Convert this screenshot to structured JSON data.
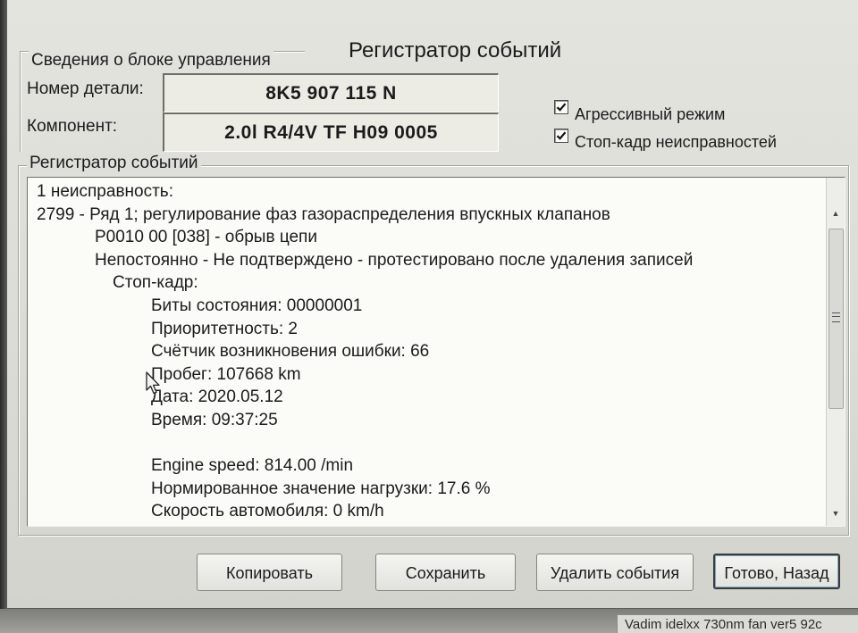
{
  "window": {
    "title": "Регистратор событий"
  },
  "control_unit": {
    "legend": "Сведения о блоке управления",
    "part_number": {
      "label": "Номер детали:",
      "value": "8K5 907 115 N"
    },
    "component": {
      "label": "Компонент:",
      "value": "2.0l R4/4V TF H09 0005"
    }
  },
  "options": [
    {
      "label": "Агрессивный режим",
      "checked": true
    },
    {
      "label": "Стоп-кадр неисправностей",
      "checked": true
    }
  ],
  "event_log": {
    "legend": "Регистратор событий",
    "lines": [
      "1 неисправность:",
      "2799 - Ряд 1; регулирование фаз газораспределения впускных клапанов",
      "P0010 00 [038] - обрыв цепи",
      "Непостоянно - Не подтверждено - протестировано после удаления записей",
      "Стоп-кадр:",
      "Биты состояния: 00000001",
      "Приоритетность: 2",
      "Счётчик возникновения ошибки: 66",
      "Пробег: 107668 km",
      "Дата: 2020.05.12",
      "Время: 09:37:25",
      "Engine speed: 814.00 /min",
      "Нормированное значение нагрузки: 17.6 %",
      "Скорость автомобиля: 0 km/h"
    ]
  },
  "buttons": {
    "copy": "Копировать",
    "save": "Сохранить",
    "delete_events": "Удалить события",
    "done_back": "Готово, Назад"
  },
  "taskbar": {
    "item": "Vadim idelxx 730nm fan ver5 92c"
  },
  "icons": {
    "checkbox_mark": "check-icon",
    "scroll_up": "triangle-up-icon",
    "scroll_down": "triangle-down-icon",
    "scroll_grip": "grip-lines-icon",
    "pointer": "arrow-cursor-icon"
  },
  "colors": {
    "dialog_bg": "#dcdcd6",
    "field_bg": "#ecece5",
    "log_bg": "#fbfbf8",
    "text": "#1b1b1b",
    "default_button_border": "#3b3b38"
  }
}
